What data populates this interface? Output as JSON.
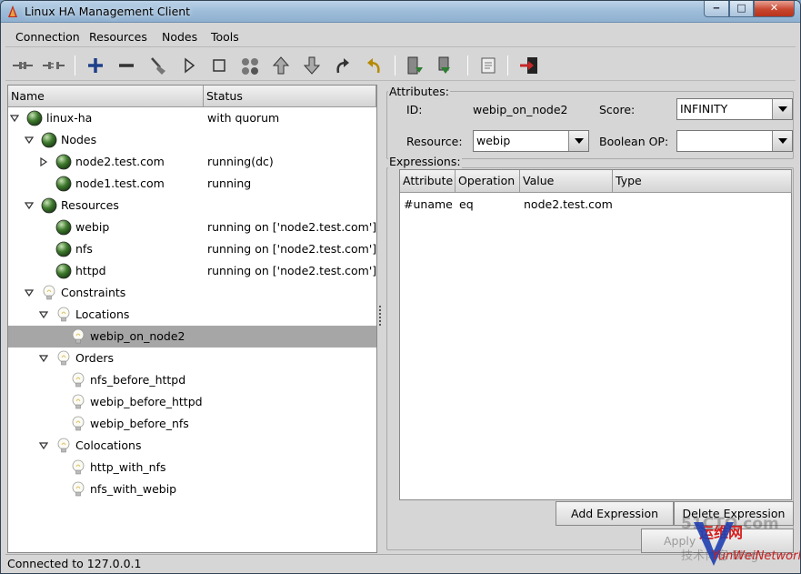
{
  "window": {
    "title": "Linux HA Management Client"
  },
  "menubar": [
    "Connection",
    "Resources",
    "Nodes",
    "Tools"
  ],
  "toolbar": [
    "connect-icon",
    "disconnect-icon",
    "add-icon",
    "remove-icon",
    "cleanup-icon",
    "start-icon",
    "stop-icon",
    "migrate-icon",
    "up-icon",
    "down-icon",
    "redo-icon",
    "undo-icon",
    "standby-icon",
    "active-icon",
    "view-icon",
    "exit-icon"
  ],
  "tree": {
    "headers": {
      "name": "Name",
      "status": "Status"
    },
    "rows": [
      {
        "label": "linux-ha",
        "status": "with quorum"
      },
      {
        "label": "Nodes",
        "status": ""
      },
      {
        "label": "node2.test.com",
        "status": "running(dc)"
      },
      {
        "label": "node1.test.com",
        "status": "running"
      },
      {
        "label": "Resources",
        "status": ""
      },
      {
        "label": "webip",
        "status": "running on ['node2.test.com']"
      },
      {
        "label": "nfs",
        "status": "running on ['node2.test.com']"
      },
      {
        "label": "httpd",
        "status": "running on ['node2.test.com']"
      },
      {
        "label": "Constraints",
        "status": ""
      },
      {
        "label": "Locations",
        "status": ""
      },
      {
        "label": "webip_on_node2",
        "status": ""
      },
      {
        "label": "Orders",
        "status": ""
      },
      {
        "label": "nfs_before_httpd",
        "status": ""
      },
      {
        "label": "webip_before_httpd",
        "status": ""
      },
      {
        "label": "webip_before_nfs",
        "status": ""
      },
      {
        "label": "Colocations",
        "status": ""
      },
      {
        "label": "http_with_nfs",
        "status": ""
      },
      {
        "label": "nfs_with_webip",
        "status": ""
      }
    ]
  },
  "attributes": {
    "title": "Attributes:",
    "id_label": "ID:",
    "id_value": "webip_on_node2",
    "score_label": "Score:",
    "score_value": "INFINITY",
    "resource_label": "Resource:",
    "resource_value": "webip",
    "boolean_label": "Boolean OP:",
    "boolean_value": ""
  },
  "expressions": {
    "title": "Expressions:",
    "headers": {
      "attribute": "Attribute",
      "operation": "Operation",
      "value": "Value",
      "type": "Type"
    },
    "row": {
      "attribute": "#uname",
      "operation": "eq",
      "value": "node2.test.com",
      "type": ""
    },
    "add_button": "Add Expression",
    "delete_button": "Delete Expression",
    "apply_button": "Apply"
  },
  "status": {
    "text": "Connected to 127.0.0.1"
  },
  "watermark": {
    "line1": "51CTO.com",
    "line2": "技术博客 Blog",
    "line3": "运维网",
    "line4": "YunWeiNetwork"
  },
  "colors": {
    "selected_row": "#a6a6a6",
    "node_green": "#3f7a2e",
    "window_bg": "#d6d6d6"
  }
}
